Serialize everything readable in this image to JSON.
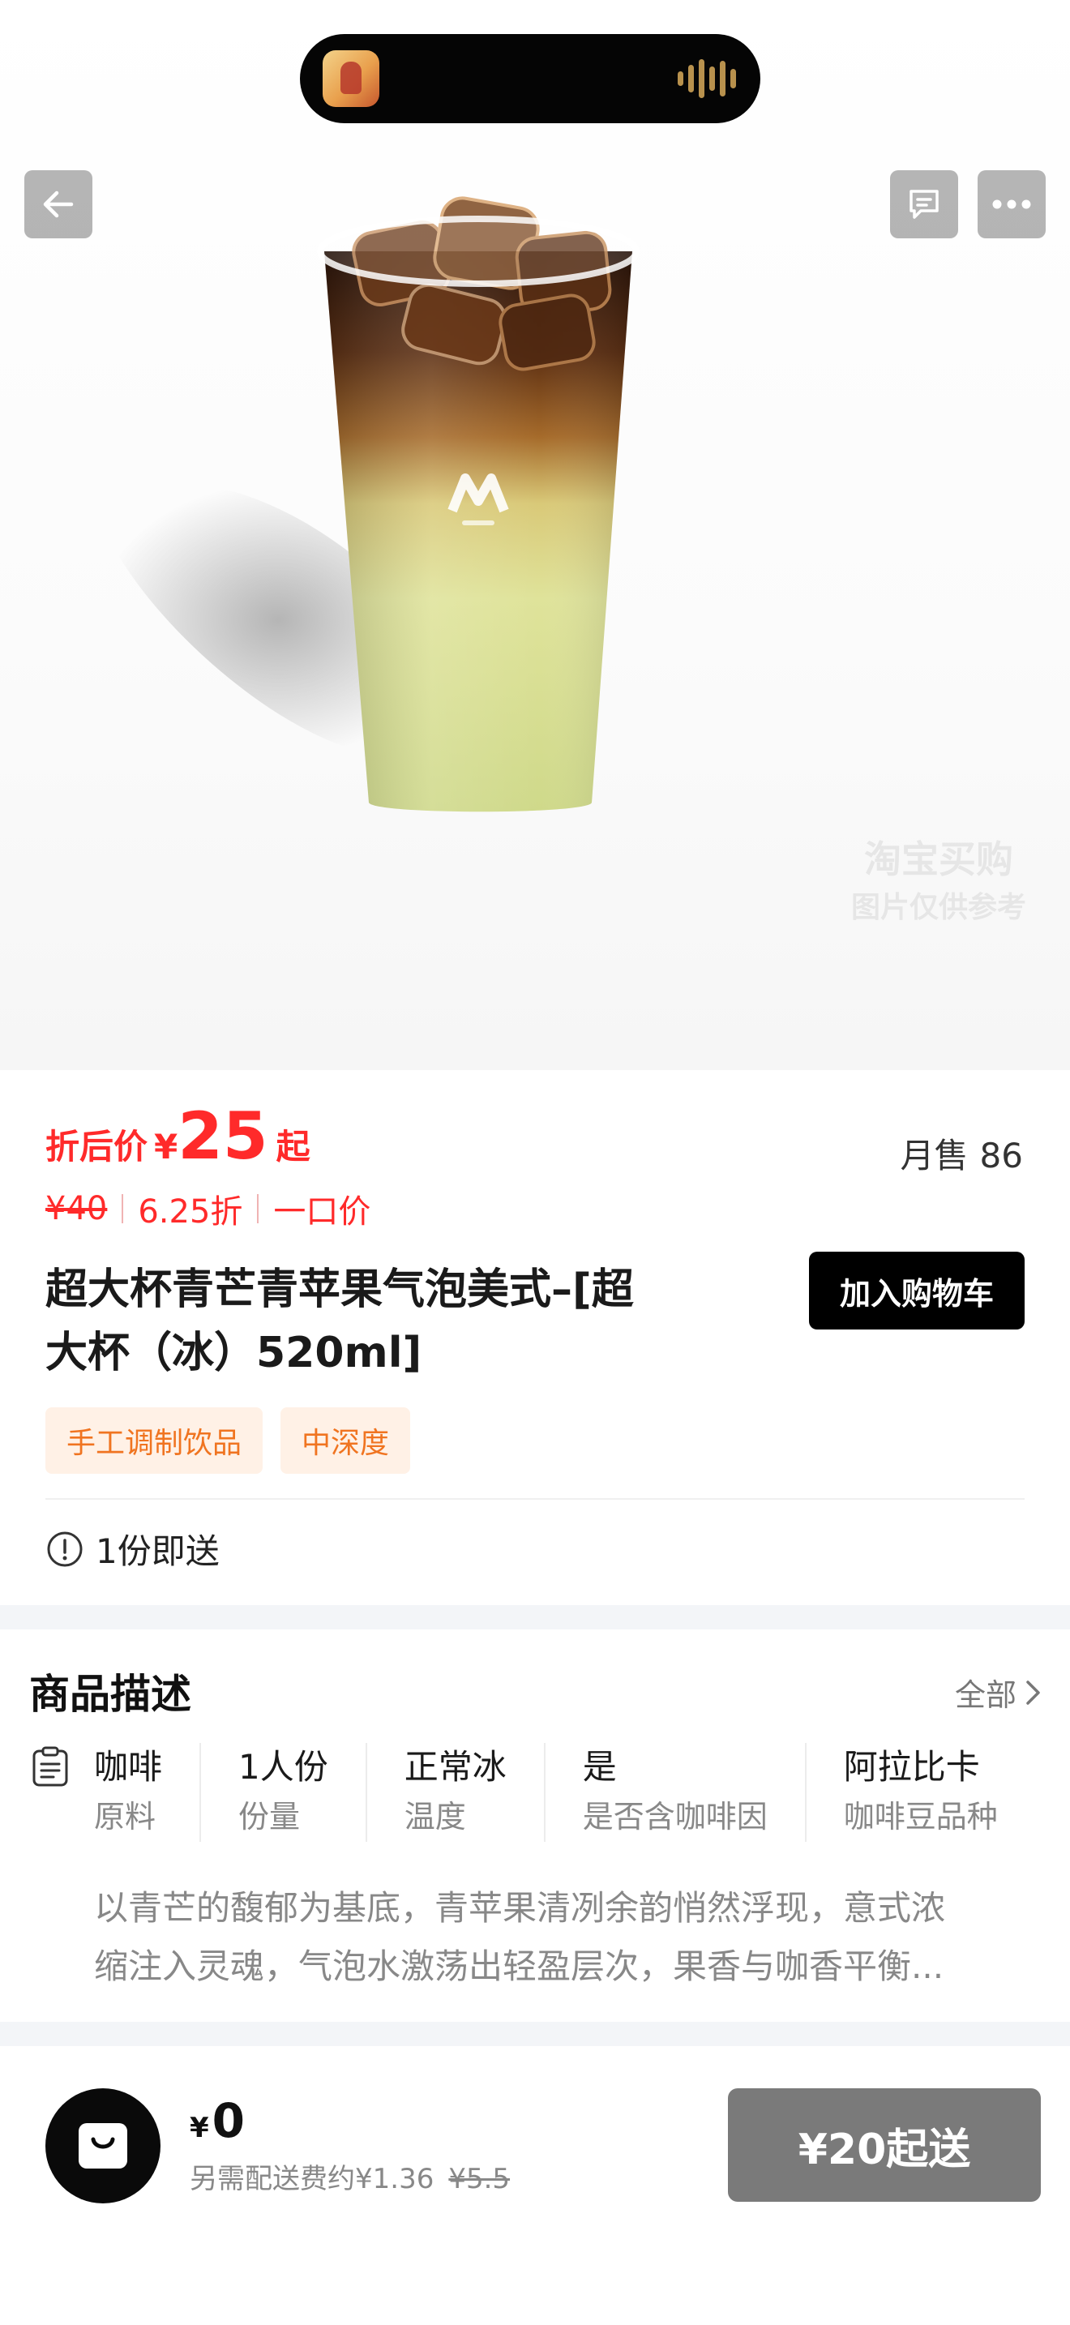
{
  "hero": {
    "watermark_line1": "淘宝买购",
    "watermark_line2": "图片仅供参考"
  },
  "price": {
    "prefix": "折后价",
    "currency": "¥",
    "value": "25",
    "suffix": "起",
    "monthly_label": "月售",
    "monthly_value": "86",
    "original": "¥40",
    "discount": "6.25折",
    "type": "一口价"
  },
  "product": {
    "title_line1": "超大杯青芒青苹果气泡美式–[超",
    "title_line2": "大杯（冰）520ml]",
    "cart_button": "加入购物车",
    "tags": [
      "手工调制饮品",
      "中深度"
    ],
    "notice": "1份即送"
  },
  "description": {
    "title": "商品描述",
    "all_link": "全部",
    "attributes": [
      {
        "value": "咖啡",
        "key": "原料"
      },
      {
        "value": "1人份",
        "key": "份量"
      },
      {
        "value": "正常冰",
        "key": "温度"
      },
      {
        "value": "是",
        "key": "是否含咖啡因"
      },
      {
        "value": "阿拉比卡",
        "key": "咖啡豆品种"
      }
    ],
    "text_line1": "以青芒的馥郁为基底，青苹果清冽余韵悄然浮现，意式浓",
    "text_line2": "缩注入灵魂，气泡水激荡出轻盈层次，果香与咖香平衡..."
  },
  "bottom": {
    "currency": "¥",
    "total": "0",
    "fee_text": "另需配送费约¥1.36",
    "fee_original": "¥5.5",
    "min_order_button": "¥20起送"
  },
  "colors": {
    "price_red": "#ff2a2a",
    "tag_orange": "#f07420",
    "tag_bg": "#fff1e6",
    "disabled_gray": "#7a7a7a"
  }
}
